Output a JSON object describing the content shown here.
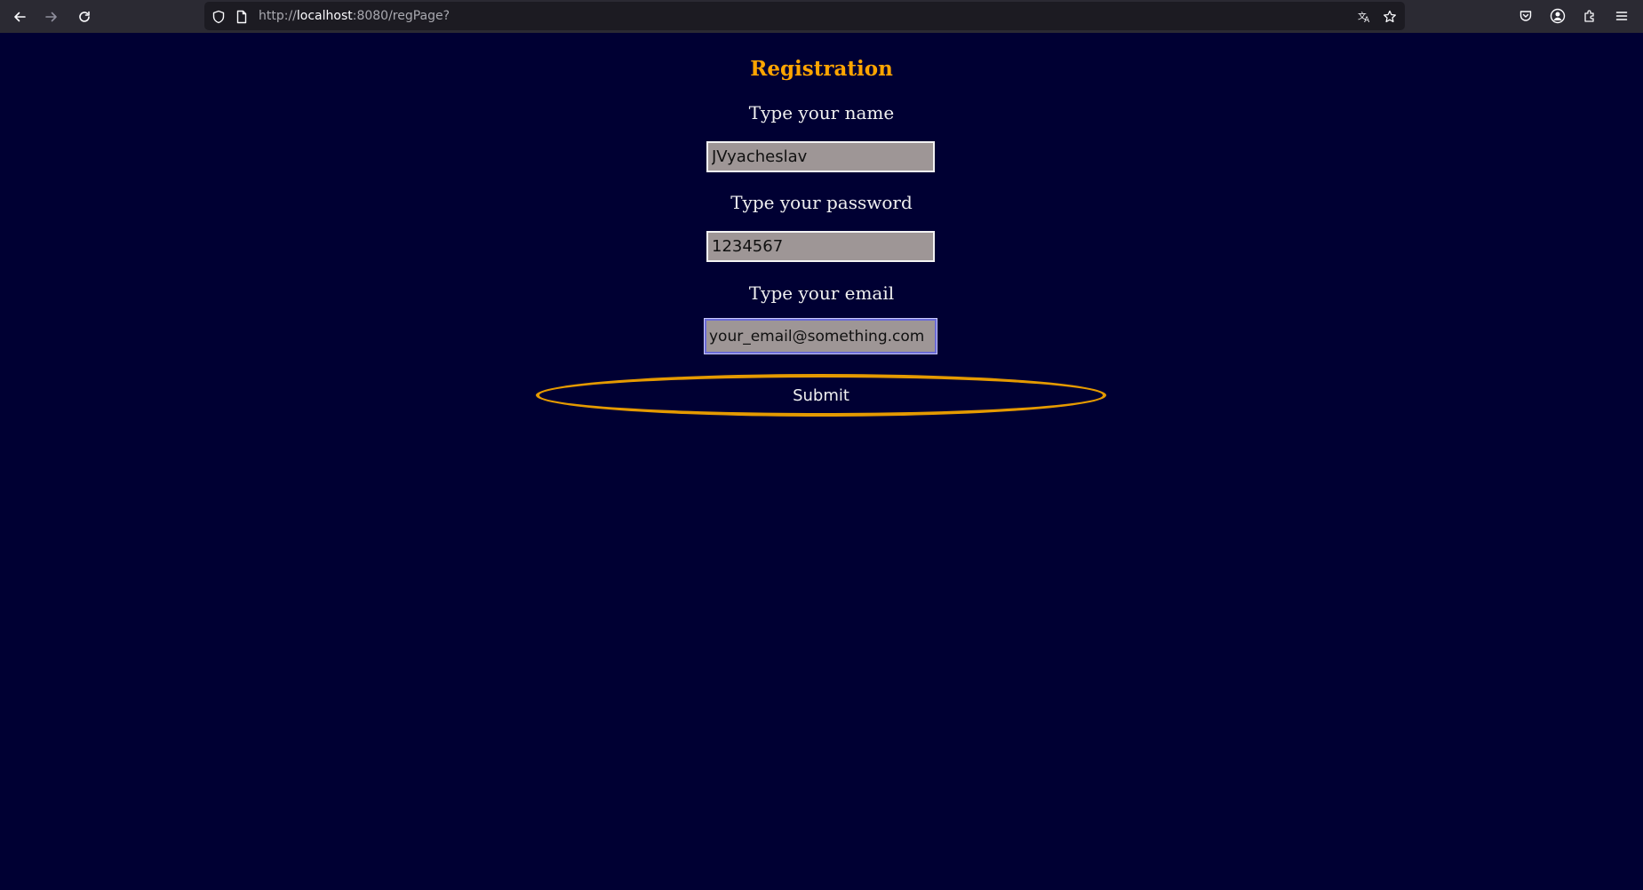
{
  "browser": {
    "url_scheme": "http://",
    "url_host": "localhost",
    "url_rest": ":8080/regPage?",
    "icons": {
      "back": "arrow-left-icon",
      "forward": "arrow-right-icon",
      "reload": "reload-icon",
      "tracking_protection": "shield-icon",
      "page_info": "page-icon",
      "translate": "translate-icon",
      "bookmark": "star-icon",
      "pocket": "pocket-icon",
      "account": "account-icon",
      "extensions": "extensions-icon",
      "menu": "hamburger-menu-icon"
    }
  },
  "page": {
    "title": "Registration",
    "name_label": "Type your name",
    "name_value": "JVyacheslav",
    "password_label": "Type your password",
    "password_value": "1234567",
    "email_label": "Type your email",
    "email_value": "your_email@something.com",
    "submit_label": "Submit"
  },
  "colors": {
    "background": "#000033",
    "title": "#ffa500",
    "button_border": "#e59a00",
    "field_background": "#9e9696"
  }
}
